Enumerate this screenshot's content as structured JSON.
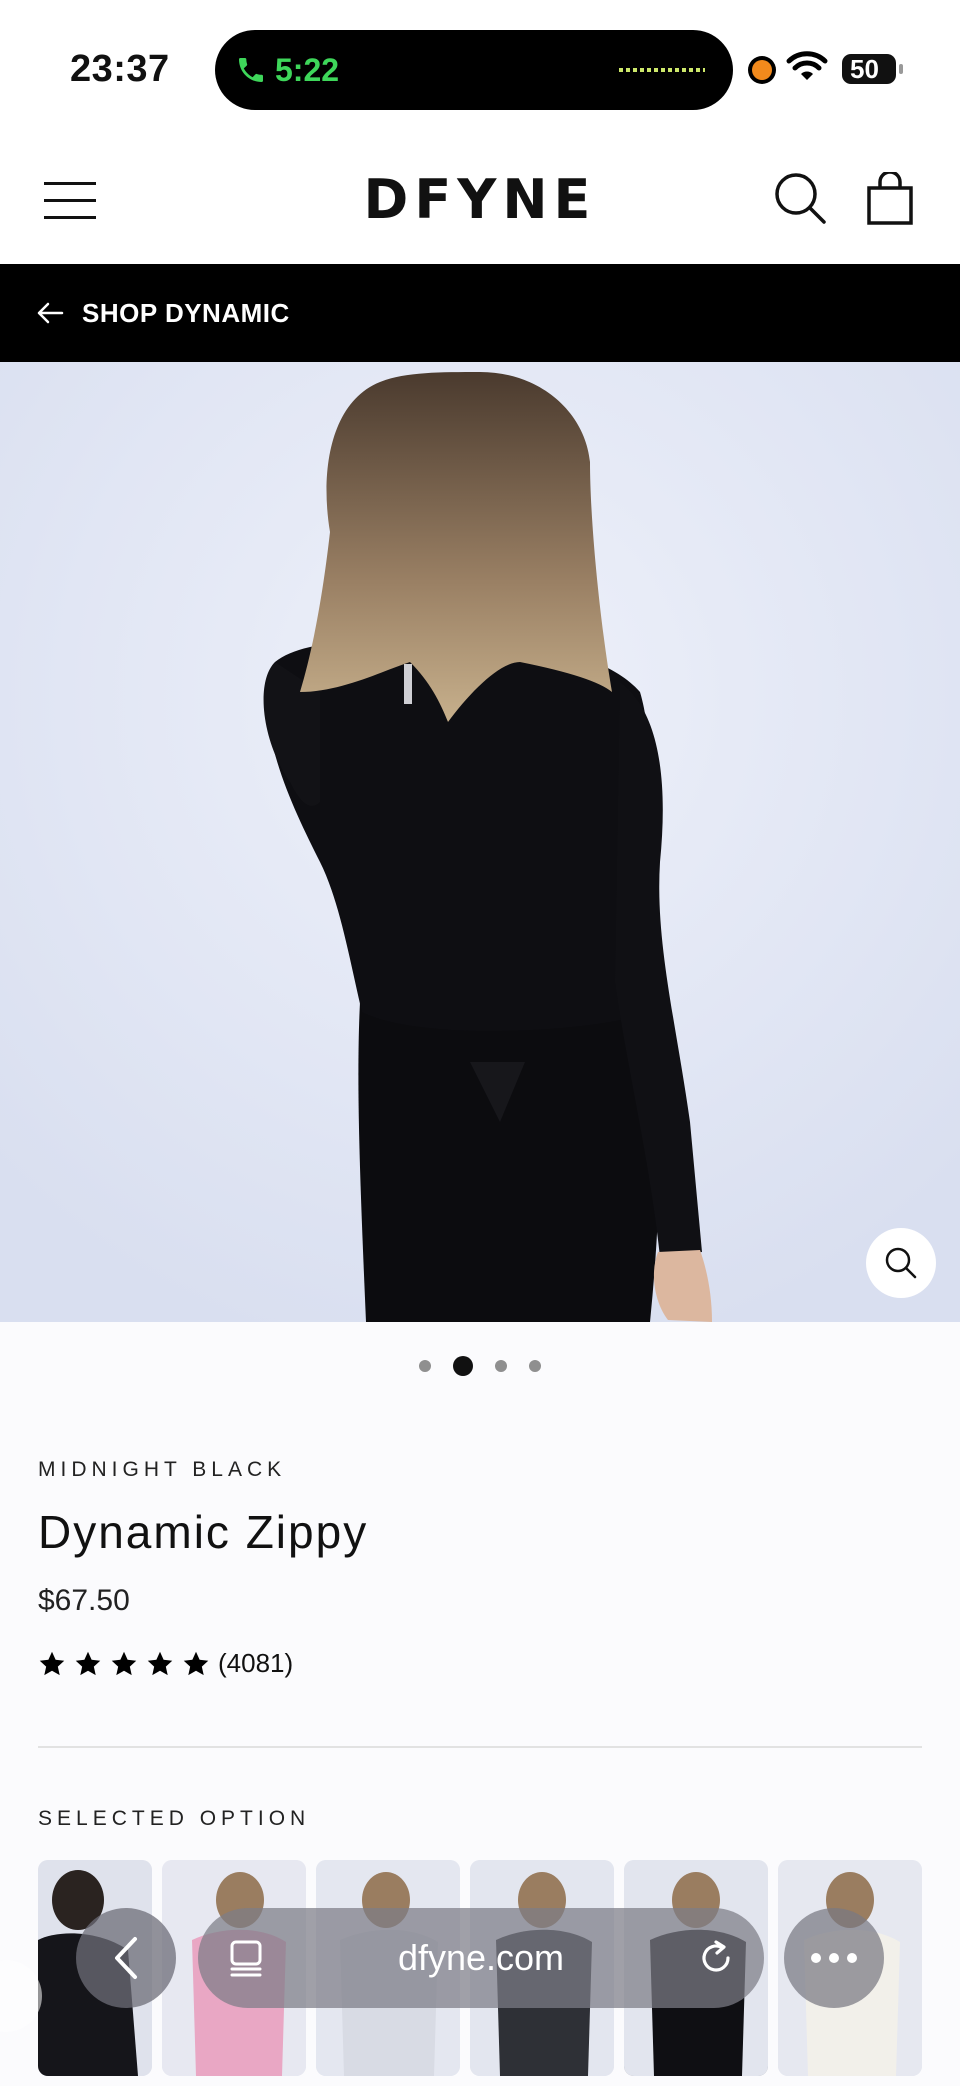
{
  "status_bar": {
    "time": "23:37",
    "call_duration": "5:22",
    "battery": "50"
  },
  "header": {
    "logo": "DFYNE"
  },
  "banner": {
    "label": "SHOP DYNAMIC"
  },
  "gallery": {
    "slide_count": 4,
    "active_slide": 2
  },
  "product": {
    "variant": "MIDNIGHT BLACK",
    "title": "Dynamic Zippy",
    "price": "$67.50",
    "rating_stars": 5,
    "review_count": "(4081)"
  },
  "options": {
    "label": "SELECTED OPTION"
  },
  "browser": {
    "url": "dfyne.com"
  },
  "colors": {
    "call_green": "#3ed65a",
    "banner_bg": "#000000",
    "hero_bg": "#e4e8f4"
  }
}
